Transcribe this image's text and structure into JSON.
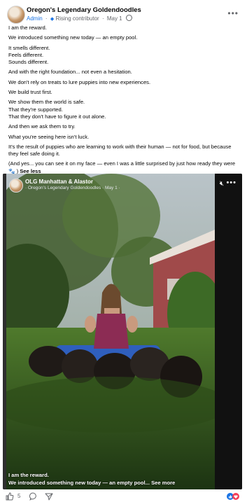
{
  "post": {
    "page_name": "Oregon's Legendary Goldendoodles",
    "role": "Admin",
    "badge": "Rising contributor",
    "date": "May 1",
    "more_icon": "more-dots-icon",
    "paragraphs": [
      "I am the reward.",
      "We introduced something new today — an empty pool.",
      "It smells different.",
      "Feels different.",
      "Sounds different.",
      "And with the right foundation... not even a hesitation.",
      "We don't rely on treats to lure puppies into new experiences.",
      "We build trust first.",
      "We show them the world is safe.",
      "That they're supported.",
      "That they don't have to figure it out alone.",
      "And then we ask them to try.",
      "What you're seeing here isn't luck.",
      "It's the result of puppies who are learning to work with their human — not for food, but because they feel safe doing it.",
      "(And yes... you can see it on my face — even I was a little surprised by just how ready they were 🐾 )"
    ],
    "see_less": "See less"
  },
  "video": {
    "name": "OLG Manhattan & Alastor",
    "sub": "· Oregon's Legendary Goldendoodles · May 1 ·",
    "caption_line1": "I am the reward.",
    "caption_line2": "We introduced something new today — an empty pool... ",
    "see_more": "See more"
  },
  "footer": {
    "like_count": "5",
    "icons": [
      "like-icon",
      "comment-icon",
      "share-icon",
      "reactions-icon"
    ]
  },
  "colors": {
    "link": "#1b74e4",
    "muted": "#65676b",
    "text": "#050505"
  }
}
